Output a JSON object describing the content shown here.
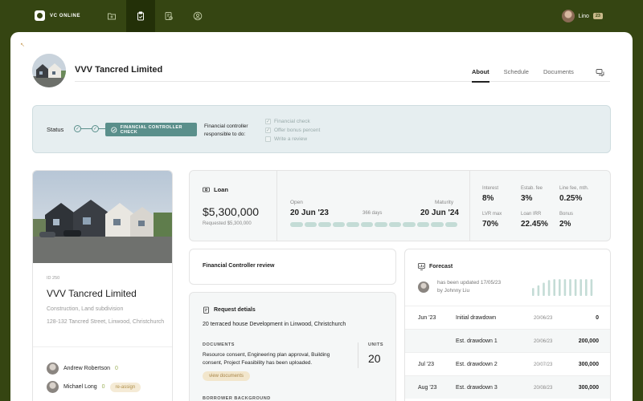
{
  "app": {
    "name": "VC ONLINE"
  },
  "nav": {
    "items": [
      "folder-icon",
      "clipboard-icon",
      "report-icon",
      "user-circle-icon"
    ],
    "active_index": 1
  },
  "user": {
    "name": "Lino",
    "badge": "23"
  },
  "page": {
    "back": "↖",
    "company": "VVV Tancred Limited",
    "tabs": [
      {
        "label": "About",
        "active": true
      },
      {
        "label": "Schedule",
        "active": false
      },
      {
        "label": "Documents",
        "active": false
      }
    ]
  },
  "status": {
    "label": "Status",
    "step_button": "FINANCIAL CONTROLLER CHECK",
    "responsible_line1": "Financial controller",
    "responsible_line2": "responsible to do:",
    "checklist": [
      {
        "label": "Financial check",
        "checked": true
      },
      {
        "label": "Offer bonus percent",
        "checked": true
      },
      {
        "label": "Write a review",
        "checked": false
      }
    ]
  },
  "property": {
    "id": "ID 250",
    "name": "VVV Tancred Limited",
    "type": "Construction, Land subdivision",
    "address": "128-132 Tancred Street, Linwood, Christchurch",
    "contacts": [
      {
        "name": "Andrew Robertson",
        "count": "0"
      },
      {
        "name": "Michael Long",
        "count": "0",
        "action": "re-assign"
      }
    ]
  },
  "loan": {
    "title": "Loan",
    "amount": "$5,300,000",
    "requested": "Requested $5,300,000",
    "open_label": "Open",
    "open_date": "20 Jun '23",
    "days": "366 days",
    "maturity_label": "Maturity",
    "maturity_date": "20 Jun '24",
    "progress_segments": 12,
    "metrics": [
      {
        "label": "Interest",
        "value": "8%"
      },
      {
        "label": "Estab. fee",
        "value": "3%"
      },
      {
        "label": "Line fee, mth.",
        "value": "0.25%"
      },
      {
        "label": "LVR max",
        "value": "70%"
      },
      {
        "label": "Loan IRR",
        "value": "22.45%"
      },
      {
        "label": "Bonus",
        "value": "2%"
      }
    ]
  },
  "review": {
    "title": "Financial Controller review"
  },
  "request": {
    "title": "Request detials",
    "description": "20 terraced house Development in Linwood, Christchurch",
    "documents_label": "DOCUMENTS",
    "documents_text": "Resource consent, Engineering plan approval, Building consent, Project Feasibility has been uploaded.",
    "units_label": "UNITS",
    "units_value": "20",
    "view_button": "view documents",
    "borrower_label": "BORROWER BACKGROUND"
  },
  "forecast": {
    "title": "Forecast",
    "updated": "has been updated 17/05/23",
    "updated_by": "by Johnny Liu",
    "sparkline": [
      0.45,
      0.6,
      0.75,
      0.9,
      0.95,
      0.95,
      0.95,
      0.95,
      0.95,
      0.95,
      0.95,
      0.95
    ],
    "rows": [
      {
        "month": "Jun '23",
        "label": "Initial drawdown",
        "date": "20/06/23",
        "amount": "0",
        "estimate": false
      },
      {
        "month": "",
        "label": "Est. drawdown 1",
        "date": "20/06/23",
        "amount": "200,000",
        "estimate": true
      },
      {
        "month": "Jul '23",
        "label": "Est. drawdown 2",
        "date": "20/07/23",
        "amount": "300,000",
        "estimate": false
      },
      {
        "month": "Aug '23",
        "label": "Est. drawdown 3",
        "date": "20/08/23",
        "amount": "300,000",
        "estimate": true
      }
    ]
  },
  "colors": {
    "brand_dark": "#354512",
    "accent_teal": "#5a8f8b",
    "bar_light": "#c4dcd6",
    "tag_bg": "#f5ebd6"
  }
}
